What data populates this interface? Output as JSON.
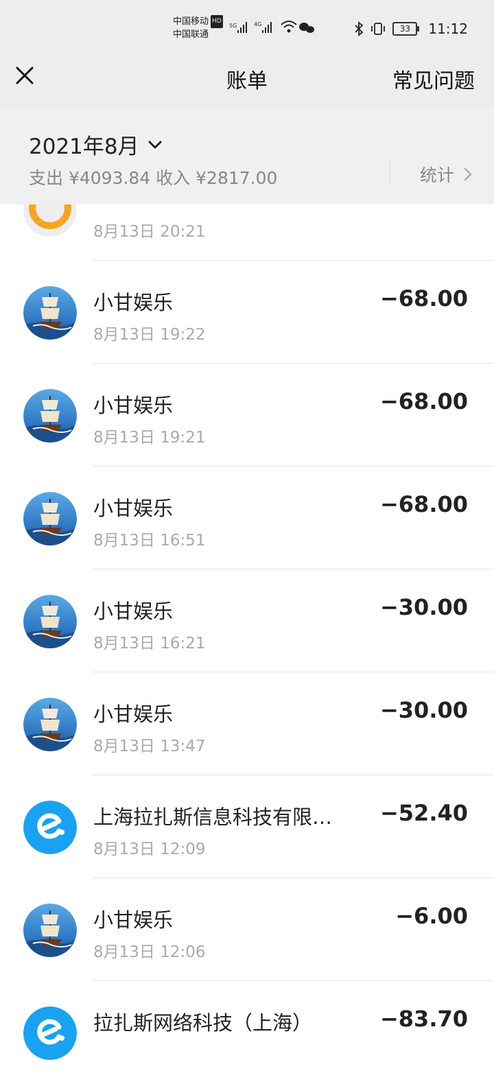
{
  "status_bar": {
    "carrier1": "中国移动",
    "carrier1_badge": "HD",
    "carrier2": "中国联通",
    "net1": "5G",
    "net2": "4G",
    "battery": "33",
    "time": "11:12"
  },
  "navbar": {
    "title": "账单",
    "faq": "常见问题"
  },
  "summary": {
    "month": "2021年8月",
    "totals": "支出 ¥4093.84 收入 ¥2817.00",
    "stats": "统计"
  },
  "transactions": [
    {
      "merchant": "",
      "time": "8月13日 20:21",
      "amount": "",
      "icon": "orange-ring-icon"
    },
    {
      "merchant": "小甘娱乐",
      "time": "8月13日 19:22",
      "amount": "−68.00",
      "icon": "sailing-ship-avatar"
    },
    {
      "merchant": "小甘娱乐",
      "time": "8月13日 19:21",
      "amount": "−68.00",
      "icon": "sailing-ship-avatar"
    },
    {
      "merchant": "小甘娱乐",
      "time": "8月13日 16:51",
      "amount": "−68.00",
      "icon": "sailing-ship-avatar"
    },
    {
      "merchant": "小甘娱乐",
      "time": "8月13日 16:21",
      "amount": "−30.00",
      "icon": "sailing-ship-avatar"
    },
    {
      "merchant": "小甘娱乐",
      "time": "8月13日 13:47",
      "amount": "−30.00",
      "icon": "sailing-ship-avatar"
    },
    {
      "merchant": "上海拉扎斯信息科技有限…",
      "time": "8月13日 12:09",
      "amount": "−52.40",
      "icon": "eleme-logo-icon"
    },
    {
      "merchant": "小甘娱乐",
      "time": "8月13日 12:06",
      "amount": "−6.00",
      "icon": "sailing-ship-avatar"
    },
    {
      "merchant": "拉扎斯网络科技（上海）",
      "time": "",
      "amount": "−83.70",
      "icon": "eleme-logo-icon"
    }
  ],
  "colors": {
    "header_bg": "#ededed",
    "summary_bg": "#f0f0f0",
    "eleme_blue": "#1aa2f0",
    "orange": "#f5a524"
  }
}
